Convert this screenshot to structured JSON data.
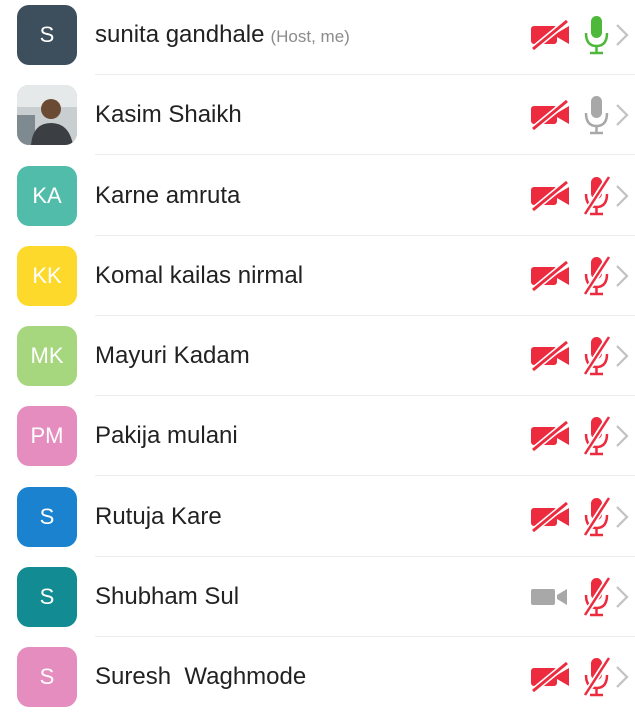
{
  "participants": [
    {
      "initials": "S",
      "avatar_color": "#3d4f5c",
      "photo": false,
      "name": "sunita gandhale",
      "tag": "(Host, me)",
      "video": "off",
      "audio": "on"
    },
    {
      "initials": "",
      "avatar_color": "#9aa6ad",
      "photo": true,
      "name": "Kasim Shaikh",
      "tag": "",
      "video": "off",
      "audio": "idle"
    },
    {
      "initials": "KA",
      "avatar_color": "#52bcaa",
      "photo": false,
      "name": "Karne amruta",
      "tag": "",
      "video": "off",
      "audio": "muted"
    },
    {
      "initials": "KK",
      "avatar_color": "#fdd92b",
      "photo": false,
      "name": "Komal kailas nirmal",
      "tag": "",
      "video": "off",
      "audio": "muted"
    },
    {
      "initials": "MK",
      "avatar_color": "#a6d67e",
      "photo": false,
      "name": "Mayuri Kadam",
      "tag": "",
      "video": "off",
      "audio": "muted"
    },
    {
      "initials": "PM",
      "avatar_color": "#e48dbe",
      "photo": false,
      "name": "Pakija mulani",
      "tag": "",
      "video": "off",
      "audio": "muted"
    },
    {
      "initials": "S",
      "avatar_color": "#1a82cf",
      "photo": false,
      "name": "Rutuja Kare",
      "tag": "",
      "video": "off",
      "audio": "muted"
    },
    {
      "initials": "S",
      "avatar_color": "#128c92",
      "photo": false,
      "name": "Shubham Sul",
      "tag": "",
      "video": "on",
      "audio": "muted"
    },
    {
      "initials": "S",
      "avatar_color": "#e48dbe",
      "photo": false,
      "name": "Suresh  Waghmode",
      "tag": "",
      "video": "off",
      "audio": "muted"
    }
  ],
  "colors": {
    "muted_red": "#ec2b3f",
    "mic_on_green": "#4eb83a",
    "icon_gray": "#a8a8a8",
    "chevron": "#c2c2c2"
  }
}
